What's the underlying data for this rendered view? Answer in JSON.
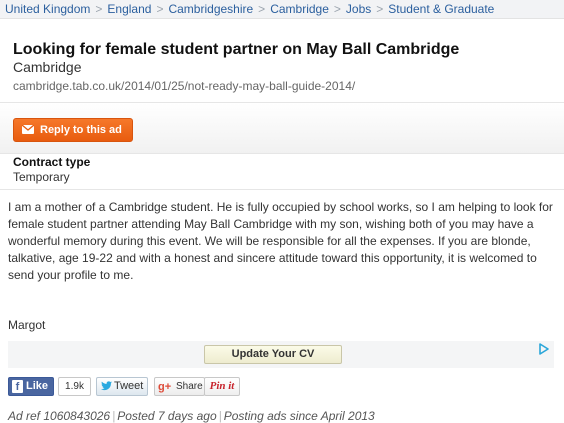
{
  "breadcrumb": [
    "United Kingdom",
    "England",
    "Cambridgeshire",
    "Cambridge",
    "Jobs",
    "Student & Graduate"
  ],
  "listing": {
    "title": "Looking for female student partner on May Ball Cambridge",
    "location": "Cambridge",
    "source_url": "cambridge.tab.co.uk/2014/01/25/not-ready-may-ball-guide-2014/"
  },
  "actions": {
    "reply_label": "Reply to this ad"
  },
  "contract": {
    "label": "Contract type",
    "value": "Temporary"
  },
  "description": "I am a mother of a Cambridge student. He is fully occupied by school works, so I am helping to look for female student partner attending May Ball Cambridge with my son, wishing both of you may have a wonderful memory during this event. We will be responsible for all the expenses. If you are blonde, talkative, age 19-22 and with a honest and sincere attitude toward this opportunity, it is welcomed to send your profile to me.",
  "signature": "Margot",
  "ad": {
    "cv_button_label": "Update Your CV",
    "icon": "adchoices-icon"
  },
  "social": {
    "like_label": "Like",
    "like_count": "1.9k",
    "tweet_label": "Tweet",
    "share_label": "Share",
    "pin_label": "Pin it"
  },
  "meta": {
    "ad_ref": "Ad ref 1060843026",
    "posted": "Posted 7 days ago",
    "posting_since": "Posting ads since April 2013"
  },
  "colors": {
    "accent_orange": "#e85c0f",
    "link_blue": "#2b5f9e",
    "facebook_blue": "#4a66a0",
    "pinterest_red": "#c8232c"
  }
}
